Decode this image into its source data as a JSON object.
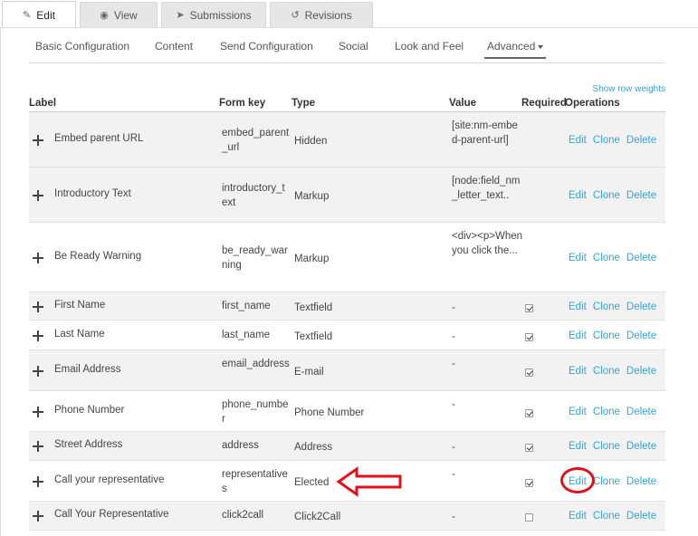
{
  "top_tabs": [
    {
      "label": "Edit",
      "icon": "pencil-icon",
      "active": true
    },
    {
      "label": "View",
      "icon": "eye-icon",
      "active": false
    },
    {
      "label": "Submissions",
      "icon": "send-icon",
      "active": false
    },
    {
      "label": "Revisions",
      "icon": "revisions-icon",
      "active": false
    }
  ],
  "subnav": [
    "Basic Configuration",
    "Content",
    "Send Configuration",
    "Social",
    "Look and Feel",
    "Advanced"
  ],
  "show_row_weights": "Show row weights",
  "table": {
    "headers": [
      "Label",
      "Form key",
      "Type",
      "Value",
      "Required",
      "Operations"
    ],
    "rows": [
      {
        "label": "Embed parent URL",
        "key": "embed_parent_url",
        "type": "Hidden",
        "value": "[site:nm-embed-parent-url]",
        "required": null
      },
      {
        "label": "Introductory Text",
        "key": "introductory_text",
        "type": "Markup",
        "value": "[node:field_nm_letter_text..",
        "required": null
      },
      {
        "label": "Be Ready Warning",
        "key": "be_ready_warning",
        "type": "Markup",
        "value": "<div><p>When you click the...",
        "required": null
      },
      {
        "label": "First Name",
        "key": "first_name",
        "type": "Textfield",
        "value": "-",
        "required": true
      },
      {
        "label": "Last Name",
        "key": "last_name",
        "type": "Textfield",
        "value": "-",
        "required": true
      },
      {
        "label": "Email Address",
        "key": "email_address",
        "type": "E-mail",
        "value": "-",
        "required": true
      },
      {
        "label": "Phone Number",
        "key": "phone_number",
        "type": "Phone Number",
        "value": "-",
        "required": true
      },
      {
        "label": "Street Address",
        "key": "address",
        "type": "Address",
        "value": "-",
        "required": true
      },
      {
        "label": "Call your representative",
        "key": "representatives",
        "type": "Elected",
        "value": "-",
        "required": true
      },
      {
        "label": "Call Your Representative",
        "key": "click2call",
        "type": "Click2Call",
        "value": "-",
        "required": false
      }
    ],
    "operations": [
      "Edit",
      "Clone",
      "Delete"
    ]
  },
  "colors": {
    "link": "#2fa6d8",
    "annotation": "#e3101a"
  }
}
